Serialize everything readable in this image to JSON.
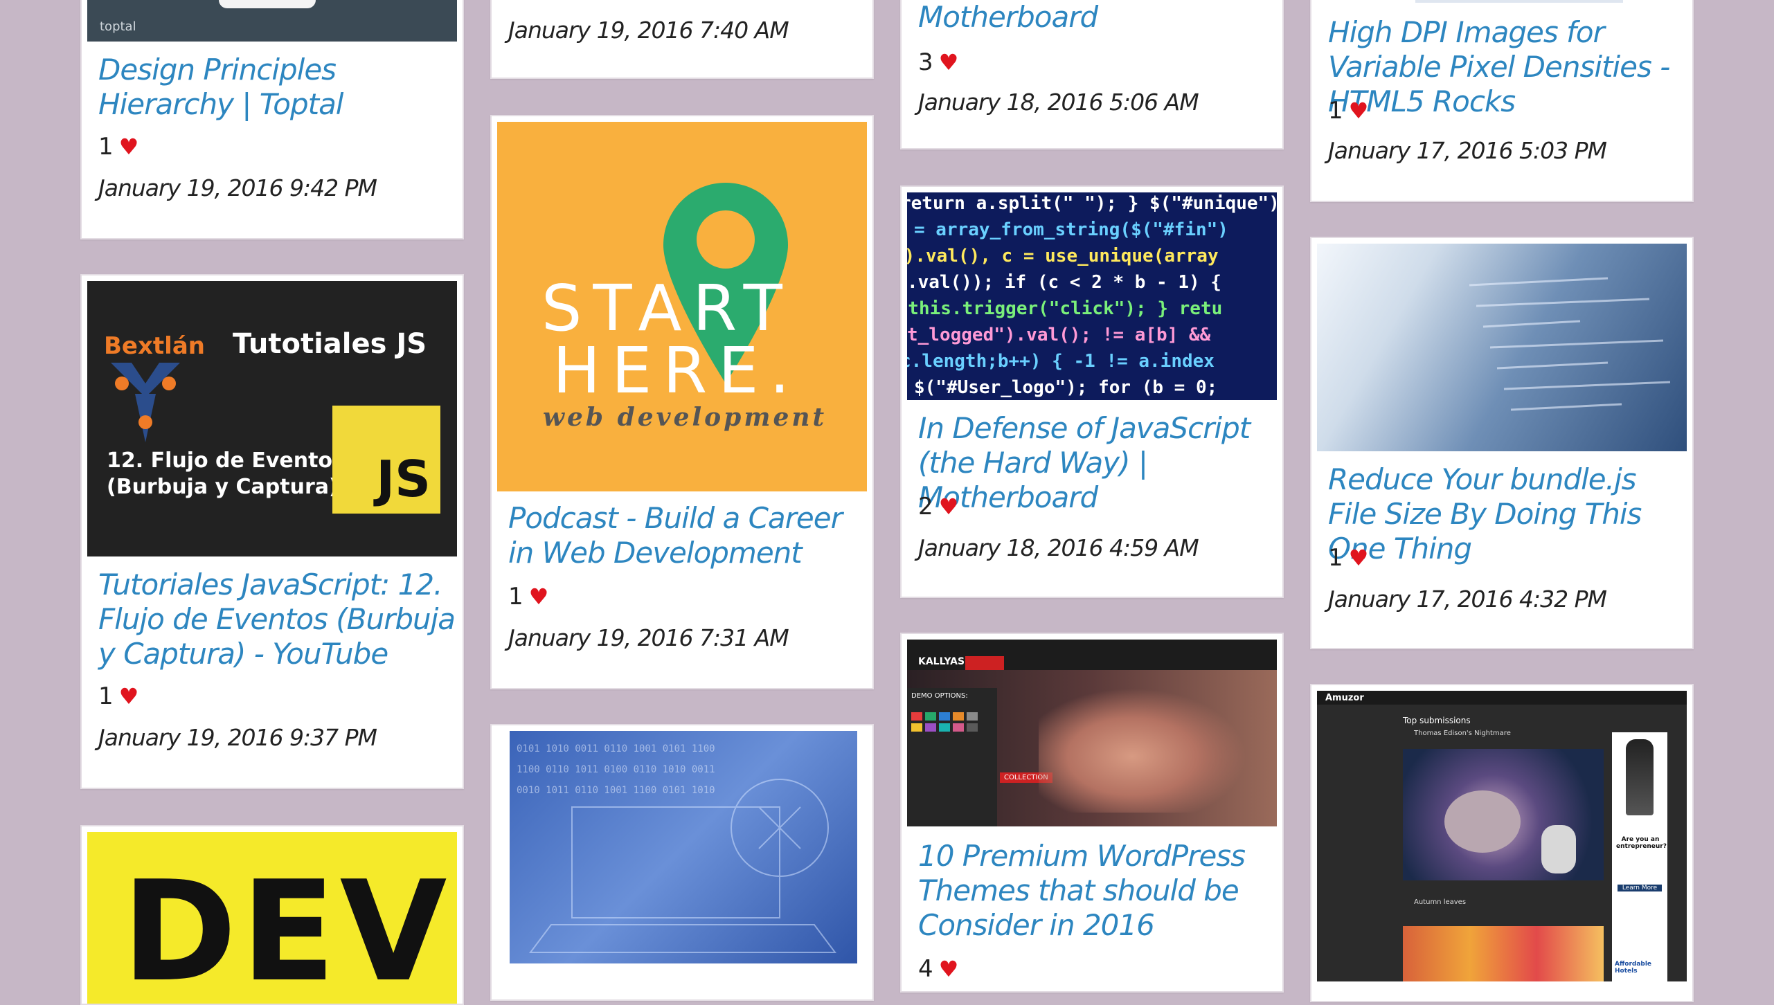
{
  "cards": {
    "c1": {
      "title": "Design Principles Hierarchy | Toptal",
      "likes": "1",
      "date": "January 19, 2016 9:42 PM",
      "thumb_text": "toptal"
    },
    "c2": {
      "title": "Tutoriales JavaScript: 12. Flujo de Eventos (Burbuja y Captura) - YouTube",
      "likes": "1",
      "date": "January 19, 2016 9:37 PM",
      "thumb": {
        "brand": "Bextlán",
        "heading": "Tutotiales JS",
        "line1": "12. Flujo de Eventos",
        "line2": "(Burbuja y Captura)",
        "badge": "JS"
      }
    },
    "c3": {
      "thumb_text": "DEV"
    },
    "c4": {
      "date": "January 19, 2016 7:40 AM"
    },
    "c5": {
      "title": "Podcast - Build a Career in Web Development",
      "likes": "1",
      "date": "January 19, 2016 7:31 AM",
      "thumb": {
        "line1": "START",
        "line2": "HERE.",
        "sub": "web development"
      }
    },
    "c6": {},
    "c7": {
      "title": "Motherboard",
      "likes": "3",
      "date": "January 18, 2016 5:06 AM"
    },
    "c8": {
      "title": "In Defense of JavaScript (the Hard Way) | Motherboard",
      "likes": "2",
      "date": "January 18, 2016 4:59 AM"
    },
    "c9": {
      "title": "10 Premium WordPress Themes that should be Consider in 2016",
      "likes": "4",
      "thumb": {
        "brand": "KALLYAS",
        "menu_label": "DEMO OPTIONS:",
        "tag": "COLLECTION"
      }
    },
    "c10": {
      "title": "High DPI Images for Variable Pixel Densities - HTML5 Rocks",
      "likes": "1",
      "date": "January 17, 2016 5:03 PM"
    },
    "c11": {
      "title": "Reduce Your bundle.js File Size By Doing This One Thing",
      "likes": "1",
      "date": "January 17, 2016 4:32 PM"
    },
    "c12": {
      "thumb": {
        "brand": "Amuzor",
        "heading": "Top submissions",
        "item1": "Thomas Edison's Nightmare",
        "item2": "Autumn leaves",
        "ad_title": "Are you an entrepreneur?",
        "ad_button": "Learn More",
        "ad_footer": "Affordable Hotels"
      }
    }
  },
  "colors": {
    "background": "#c6b7c6",
    "link": "#2d86c0",
    "heart": "#e0141e"
  },
  "icons": {
    "like": "heart-icon"
  }
}
